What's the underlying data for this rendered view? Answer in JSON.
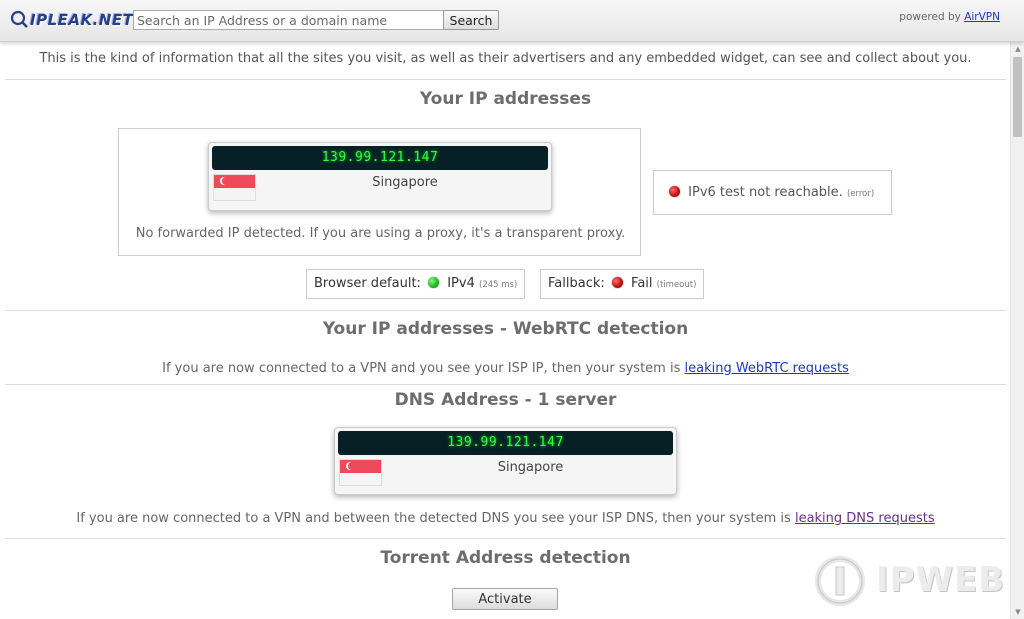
{
  "header": {
    "logo_text": "IPLEAK.NET",
    "search_placeholder": "Search an IP Address or a domain name",
    "search_button": "Search",
    "powered_prefix": "powered by",
    "powered_link": "AirVPN"
  },
  "intro_text": "This is the kind of information that all the sites you visit, as well as their advertisers and any embedded widget, can see and collect about you.",
  "ip_section": {
    "title": "Your IP addresses",
    "ip": "139.99.121.147",
    "country": "Singapore",
    "no_forward_text": "No forwarded IP detected. If you are using a proxy, it's a transparent proxy.",
    "ipv6_text": "IPv6 test not reachable.",
    "ipv6_note": "(error)",
    "browser_default_label": "Browser default:",
    "browser_default_value": "IPv4",
    "browser_default_note": "(245 ms)",
    "fallback_label": "Fallback:",
    "fallback_value": "Fail",
    "fallback_note": "(timeout)"
  },
  "webrtc_section": {
    "title": "Your IP addresses - WebRTC detection",
    "text": "If you are now connected to a VPN and you see your ISP IP, then your system is",
    "link": "leaking WebRTC requests"
  },
  "dns_section": {
    "title": "DNS Address - 1 server",
    "ip": "139.99.121.147",
    "country": "Singapore",
    "text": "If you are now connected to a VPN and between the detected DNS you see your ISP DNS, then your system is",
    "link": "leaking DNS requests"
  },
  "torrent_section": {
    "title": "Torrent Address detection",
    "button": "Activate"
  },
  "watermark": "IPWEB",
  "colors": {
    "ip_display_bg": "#072025",
    "ip_display_text": "#2bff3a",
    "status_ok": "#15a315",
    "status_fail": "#b50000",
    "link": "#1a39c8"
  }
}
